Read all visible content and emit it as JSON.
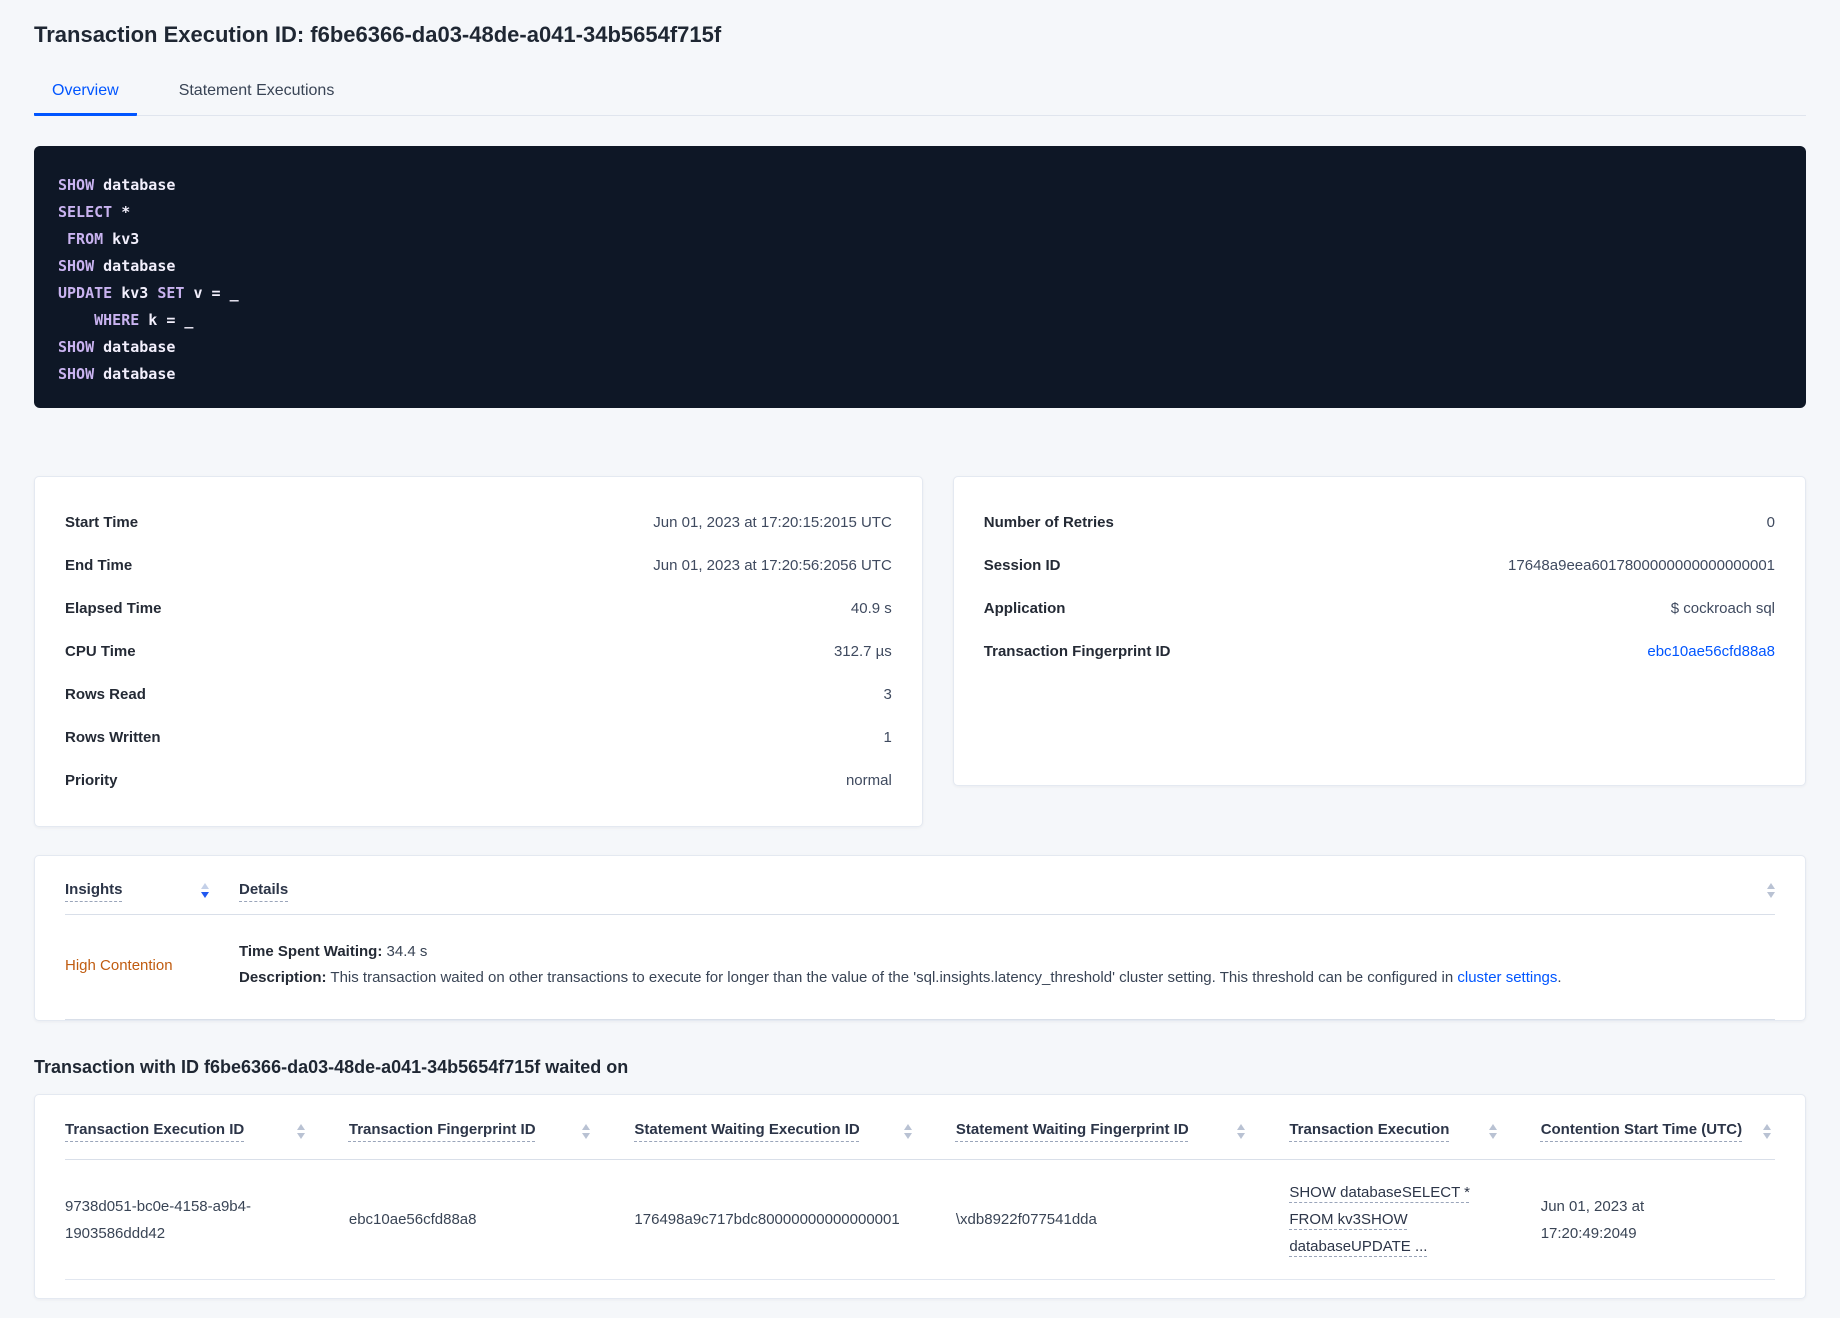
{
  "page": {
    "title": "Transaction Execution ID: f6be6366-da03-48de-a041-34b5654f715f"
  },
  "tabs": [
    {
      "label": "Overview",
      "active": true
    },
    {
      "label": "Statement Executions",
      "active": false
    }
  ],
  "sql": {
    "lines": [
      [
        {
          "t": "SHOW",
          "k": true
        },
        {
          "t": " database",
          "k": false
        }
      ],
      [
        {
          "t": "SELECT",
          "k": true
        },
        {
          "t": " *",
          "k": false
        }
      ],
      [
        {
          "t": " ",
          "k": false
        },
        {
          "t": "FROM",
          "k": true
        },
        {
          "t": " kv3",
          "k": false
        }
      ],
      [
        {
          "t": "SHOW",
          "k": true
        },
        {
          "t": " database",
          "k": false
        }
      ],
      [
        {
          "t": "UPDATE",
          "k": true
        },
        {
          "t": " kv3 ",
          "k": false
        },
        {
          "t": "SET",
          "k": true
        },
        {
          "t": " v = _",
          "k": false
        }
      ],
      [
        {
          "t": "    ",
          "k": false
        },
        {
          "t": "WHERE",
          "k": true
        },
        {
          "t": " k = _",
          "k": false
        }
      ],
      [
        {
          "t": "SHOW",
          "k": true
        },
        {
          "t": " database",
          "k": false
        }
      ],
      [
        {
          "t": "SHOW",
          "k": true
        },
        {
          "t": " database",
          "k": false
        }
      ]
    ]
  },
  "execution_card": {
    "rows": [
      {
        "label": "Start Time",
        "value": "Jun 01, 2023 at 17:20:15:2015 UTC"
      },
      {
        "label": "End Time",
        "value": "Jun 01, 2023 at 17:20:56:2056 UTC"
      },
      {
        "label": "Elapsed Time",
        "value": "40.9 s"
      },
      {
        "label": "CPU Time",
        "value": "312.7 µs"
      },
      {
        "label": "Rows Read",
        "value": "3"
      },
      {
        "label": "Rows Written",
        "value": "1"
      },
      {
        "label": "Priority",
        "value": "normal"
      }
    ]
  },
  "session_card": {
    "rows": [
      {
        "label": "Number of Retries",
        "value": "0"
      },
      {
        "label": "Session ID",
        "value": "17648a9eea6017800000000000000001"
      },
      {
        "label": "Application",
        "value": "$ cockroach sql"
      },
      {
        "label": "Transaction Fingerprint ID",
        "value": "ebc10ae56cfd88a8",
        "link": true
      }
    ]
  },
  "insights_table": {
    "columns": [
      "Insights",
      "Details"
    ],
    "sort": "desc",
    "row": {
      "insight": "High Contention",
      "waiting_label": "Time Spent Waiting:",
      "waiting_value": " 34.4 s",
      "description_label": "Description:",
      "description_text": " This transaction waited on other transactions to execute for longer than the value of the 'sql.insights.latency_threshold' cluster setting. This threshold can be configured in ",
      "link_text": "cluster settings",
      "after_link": "."
    }
  },
  "waited_on": {
    "title": "Transaction with ID f6be6366-da03-48de-a041-34b5654f715f waited on",
    "columns": [
      "Transaction Execution ID",
      "Transaction Fingerprint ID",
      "Statement Waiting Execution ID",
      "Statement Waiting Fingerprint ID",
      "Transaction Execution",
      "Contention Start Time (UTC)"
    ],
    "rows": [
      {
        "transaction_execution_id": "9738d051-bc0e-4158-a9b4-1903586ddd42",
        "transaction_fingerprint_id": "ebc10ae56cfd88a8",
        "statement_waiting_execution_id": "176498a9c717bdc80000000000000001",
        "statement_waiting_fingerprint_id": "\\xdb8922f077541dda",
        "transaction_execution": "SHOW databaseSELECT * FROM kv3SHOW databaseUPDATE ...",
        "contention_start_time": "Jun 01, 2023 at 17:20:49:2049"
      }
    ]
  },
  "icons": {
    "sort": "sort-arrows-icon"
  },
  "colors": {
    "accent_blue": "#0055ff",
    "insight_orange": "#c05c10",
    "code_background": "#0e1726",
    "code_keyword": "#c9b3f0",
    "code_text": "#f2effc",
    "page_background": "#f5f7fa"
  }
}
